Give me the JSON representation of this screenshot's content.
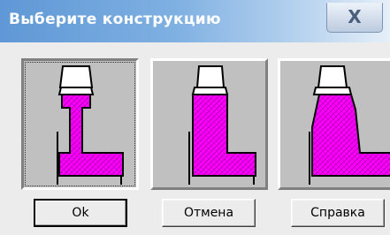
{
  "window": {
    "title": "Выберите конструкцию",
    "close_label": "X"
  },
  "options": [
    {
      "name": "profile-thin-web",
      "selected": true
    },
    {
      "name": "profile-full-web",
      "selected": false
    },
    {
      "name": "profile-tapered-web",
      "selected": false
    }
  ],
  "buttons": {
    "ok_label": "Ok",
    "cancel_label": "Отмена",
    "help_label": "Справка"
  },
  "colors": {
    "accent": "#ff00ff",
    "title_bar": "#5f98d6",
    "panel": "#c0c0c0"
  }
}
